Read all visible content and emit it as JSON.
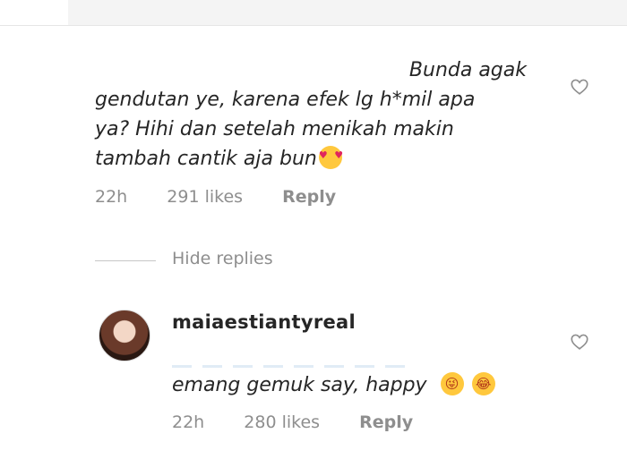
{
  "parent_comment": {
    "lines": [
      "Bunda agak",
      "gendutan ye, karena efek lg h*mil apa",
      "ya? Hihi dan setelah menikah makin",
      "tambah cantik aja bun"
    ],
    "emoji": "heart-eyes-emoji",
    "time": "22h",
    "likes": "291 likes",
    "reply_label": "Reply",
    "like_icon": "heart-outline-icon"
  },
  "hide_replies": "Hide replies",
  "reply": {
    "username": "maiaestiantyreal",
    "text": "emang gemuk say, happy",
    "emojis": [
      "winking-tongue-emoji",
      "tears-of-joy-emoji"
    ],
    "time": "22h",
    "likes": "280 likes",
    "reply_label": "Reply",
    "like_icon": "heart-outline-icon"
  },
  "colors": {
    "text": "#262626",
    "meta": "#8e8e8e",
    "divider": "#c7c7c7",
    "emoji": "#ffc83d"
  }
}
